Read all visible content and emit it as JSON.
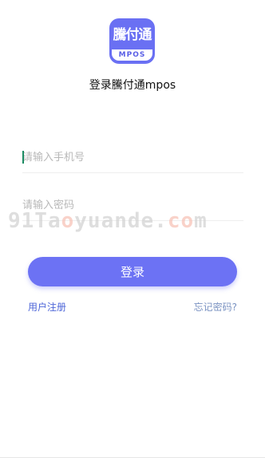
{
  "logo": {
    "title": "騰付通",
    "subtitle": "MPOS"
  },
  "app": {
    "name": "登录騰付通mpos"
  },
  "form": {
    "phone": {
      "placeholder": "请输入手机号",
      "value": ""
    },
    "password": {
      "placeholder": "请输入密码",
      "value": ""
    },
    "login_label": "登录"
  },
  "links": {
    "register": "用户注册",
    "forgot": "忘记密码?"
  },
  "watermark": {
    "text_prefix": "91Ta",
    "text_accent": "o",
    "text_mid": "yuande.",
    "text_accent2": "co",
    "text_suffix": "m"
  },
  "colors": {
    "accent": "#6c72f4",
    "register_link": "#4e66d8",
    "forgot_link": "#7b93c2",
    "caret": "#1b8b62"
  }
}
